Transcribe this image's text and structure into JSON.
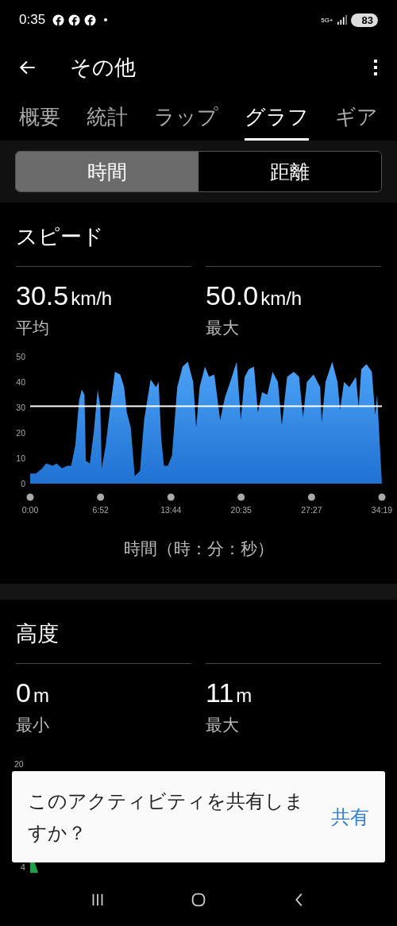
{
  "status_bar": {
    "time": "0:35",
    "notification_icons": [
      {
        "kind": "facebook"
      },
      {
        "kind": "facebook"
      },
      {
        "kind": "facebook"
      }
    ],
    "network": "5G+",
    "battery": "83"
  },
  "app_bar": {
    "title": "その他"
  },
  "tabs": [
    {
      "label": "概要",
      "selected": false
    },
    {
      "label": "統計",
      "selected": false
    },
    {
      "label": "ラップ",
      "selected": false
    },
    {
      "label": "グラフ",
      "selected": true
    },
    {
      "label": "ギア",
      "selected": false
    }
  ],
  "segments": [
    {
      "label": "時間",
      "selected": true
    },
    {
      "label": "距離",
      "selected": false
    }
  ],
  "speed": {
    "title": "スピード",
    "stats": [
      {
        "value": "30.5",
        "unit": "km/h",
        "label": "平均"
      },
      {
        "value": "50.0",
        "unit": "km/h",
        "label": "最大"
      }
    ],
    "chart_data": {
      "type": "area",
      "xlabel": "時間（時：分：秒）",
      "x": [
        0,
        34,
        70,
        93,
        132,
        155,
        186,
        217,
        240,
        264,
        287,
        302,
        318,
        326,
        349,
        372,
        395,
        411,
        419,
        442,
        465,
        496,
        527,
        550,
        566,
        589,
        612,
        643,
        667,
        705,
        736,
        752,
        767,
        783,
        806,
        830,
        861,
        892,
        923,
        954,
        972,
        992,
        1023,
        1047,
        1078,
        1112,
        1140,
        1171,
        1209,
        1233,
        1256,
        1279,
        1310,
        1333,
        1357,
        1388,
        1419,
        1450,
        1473,
        1504,
        1543,
        1574,
        1597,
        1620,
        1659,
        1698,
        1706,
        1729,
        1768,
        1799,
        1814,
        1837,
        1868,
        1907,
        1923,
        1938,
        1969,
        2000,
        2020,
        2031,
        2059
      ],
      "series": [
        {
          "color": "#4ca2f6",
          "values": [
            4,
            4,
            6,
            8,
            7,
            8,
            6,
            7,
            7,
            15,
            33,
            37,
            35,
            9,
            8,
            20,
            37,
            30,
            6,
            15,
            28,
            44,
            43,
            38,
            28,
            22,
            3,
            5,
            25,
            41,
            38,
            40,
            18,
            7,
            7,
            11,
            38,
            46,
            48,
            40,
            22,
            38,
            46,
            42,
            43,
            25,
            34,
            40,
            48,
            25,
            42,
            45,
            46,
            28,
            36,
            35,
            44,
            40,
            23,
            42,
            44,
            42,
            26,
            40,
            43,
            38,
            24,
            40,
            48,
            40,
            29,
            40,
            38,
            42,
            30,
            45,
            47,
            44,
            27,
            35,
            0
          ]
        }
      ],
      "xlim": [
        0,
        2059
      ],
      "ylim": [
        0,
        50
      ],
      "xticks": [
        {
          "value": 0,
          "label": "0:00"
        },
        {
          "value": 412,
          "label": "6:52"
        },
        {
          "value": 824,
          "label": "13:44"
        },
        {
          "value": 1235,
          "label": "20:35"
        },
        {
          "value": 1647,
          "label": "27:27"
        },
        {
          "value": 2059,
          "label": "34:19"
        }
      ],
      "yticks": [
        0,
        10,
        20,
        30,
        40,
        50
      ]
    }
  },
  "altitude": {
    "title": "高度",
    "stats": [
      {
        "value": "0",
        "unit": "m",
        "label": "最小"
      },
      {
        "value": "11",
        "unit": "m",
        "label": "最大"
      }
    ],
    "axis_labels": [
      "20",
      "4"
    ]
  },
  "snackbar": {
    "message": "このアクティビティを共有しますか？",
    "action": "共有"
  }
}
